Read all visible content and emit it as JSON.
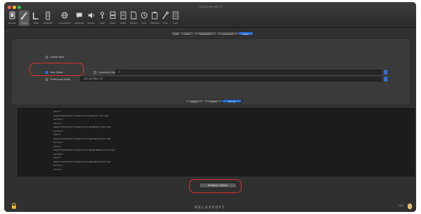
{
  "window": {
    "title": "RoboServer v5.0.4",
    "traffic_colors": [
      "#fc5f57",
      "#fdbc2e",
      "#28c840"
    ]
  },
  "toolbar": {
    "items": [
      {
        "label": "Devices",
        "icon": "device-icon"
      },
      {
        "label": "Actions",
        "icon": "brush-icon"
      },
      {
        "label": "Scale",
        "icon": "ruler-icon"
      },
      {
        "label": "Controller",
        "icon": "controller-icon"
      },
      {
        "label": "Connections",
        "icon": "network-icon"
      },
      {
        "label": "Language",
        "icon": "chat-icon"
      },
      {
        "label": "Sounds",
        "icon": "speaker-icon"
      },
      {
        "label": "Login",
        "icon": "key-icon"
      },
      {
        "label": "Hosts",
        "icon": "server-icon"
      },
      {
        "label": "Hosts",
        "icon": "list-icon"
      },
      {
        "label": "Reports",
        "icon": "document-icon"
      },
      {
        "label": "Sync",
        "icon": "sync-icon"
      },
      {
        "label": "Clipboard",
        "icon": "clipboard-icon"
      },
      {
        "label": "Tools",
        "icon": "wrench-icon"
      },
      {
        "label": "Logs",
        "icon": "log-icon"
      }
    ]
  },
  "tabs": [
    "Link",
    "Shell",
    "Transfer/Port",
    "Connection",
    "Export"
  ],
  "tabs_selected": 4,
  "form": {
    "enable_label": "Enable Shell",
    "new_option_label": "New Detect",
    "connection_label": "Connection Name",
    "connection_value": "1",
    "preferences_label": "Preferences Mode",
    "preferences_value": "1/17 (x 0.04) - 15"
  },
  "output_tabs": [
    "Aligned",
    "Content",
    "API Url"
  ],
  "output_tabs_selected": 2,
  "code_lines": [
    "<dict>",
    "  <key>TransferPort</key><string>port</string>",
    "  <array/>",
    "  <dict/>",
    "  <key>TransferPort</key><string>Master</string>",
    "  <array/>",
    "  <dict>",
    "  <key>TransferPort</key><string>enable</string>",
    "  <array/>",
    "  <dict>",
    "  <key>TransferPort</key><string>Parameter</string>",
    "  <array/>",
    "  <dict>",
    "  <key>TransferPort</key><string>Enable</string>",
    "  <array/>",
    "  <dict/>"
  ],
  "publish_label": "Publish to System",
  "footer": {
    "brand": "RELAXSOFT",
    "help_label": "Help",
    "lock_icon": "lock-icon"
  },
  "accent_color": "#2c6fd6",
  "highlight_color": "#d8322b"
}
